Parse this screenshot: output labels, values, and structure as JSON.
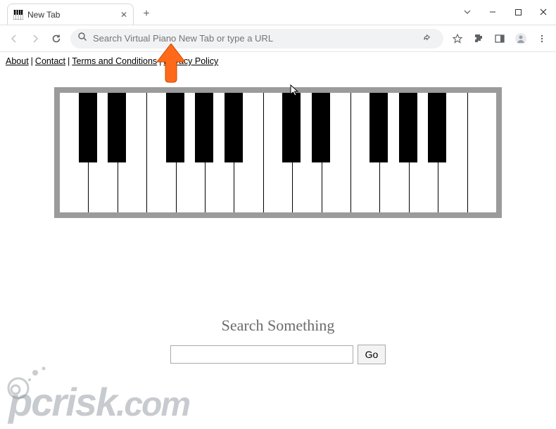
{
  "browser": {
    "tab": {
      "title": "New Tab",
      "favicon": "piano-icon"
    },
    "omnibox": {
      "placeholder": "Search Virtual Piano New Tab or type a URL",
      "value": ""
    }
  },
  "page": {
    "links": [
      {
        "label": "About"
      },
      {
        "label": "Contact"
      },
      {
        "label": "Terms and Conditions"
      },
      {
        "label": "Privacy Policy"
      }
    ],
    "search": {
      "heading": "Search Something",
      "go_label": "Go",
      "input_value": ""
    }
  },
  "piano": {
    "white_key_count": 15,
    "black_key_positions_pct": [
      4.3,
      11.0,
      24.3,
      31.0,
      37.7,
      51.0,
      57.7,
      71.0,
      77.7,
      84.3
    ]
  },
  "watermark": {
    "text": "pcrisk.com"
  }
}
